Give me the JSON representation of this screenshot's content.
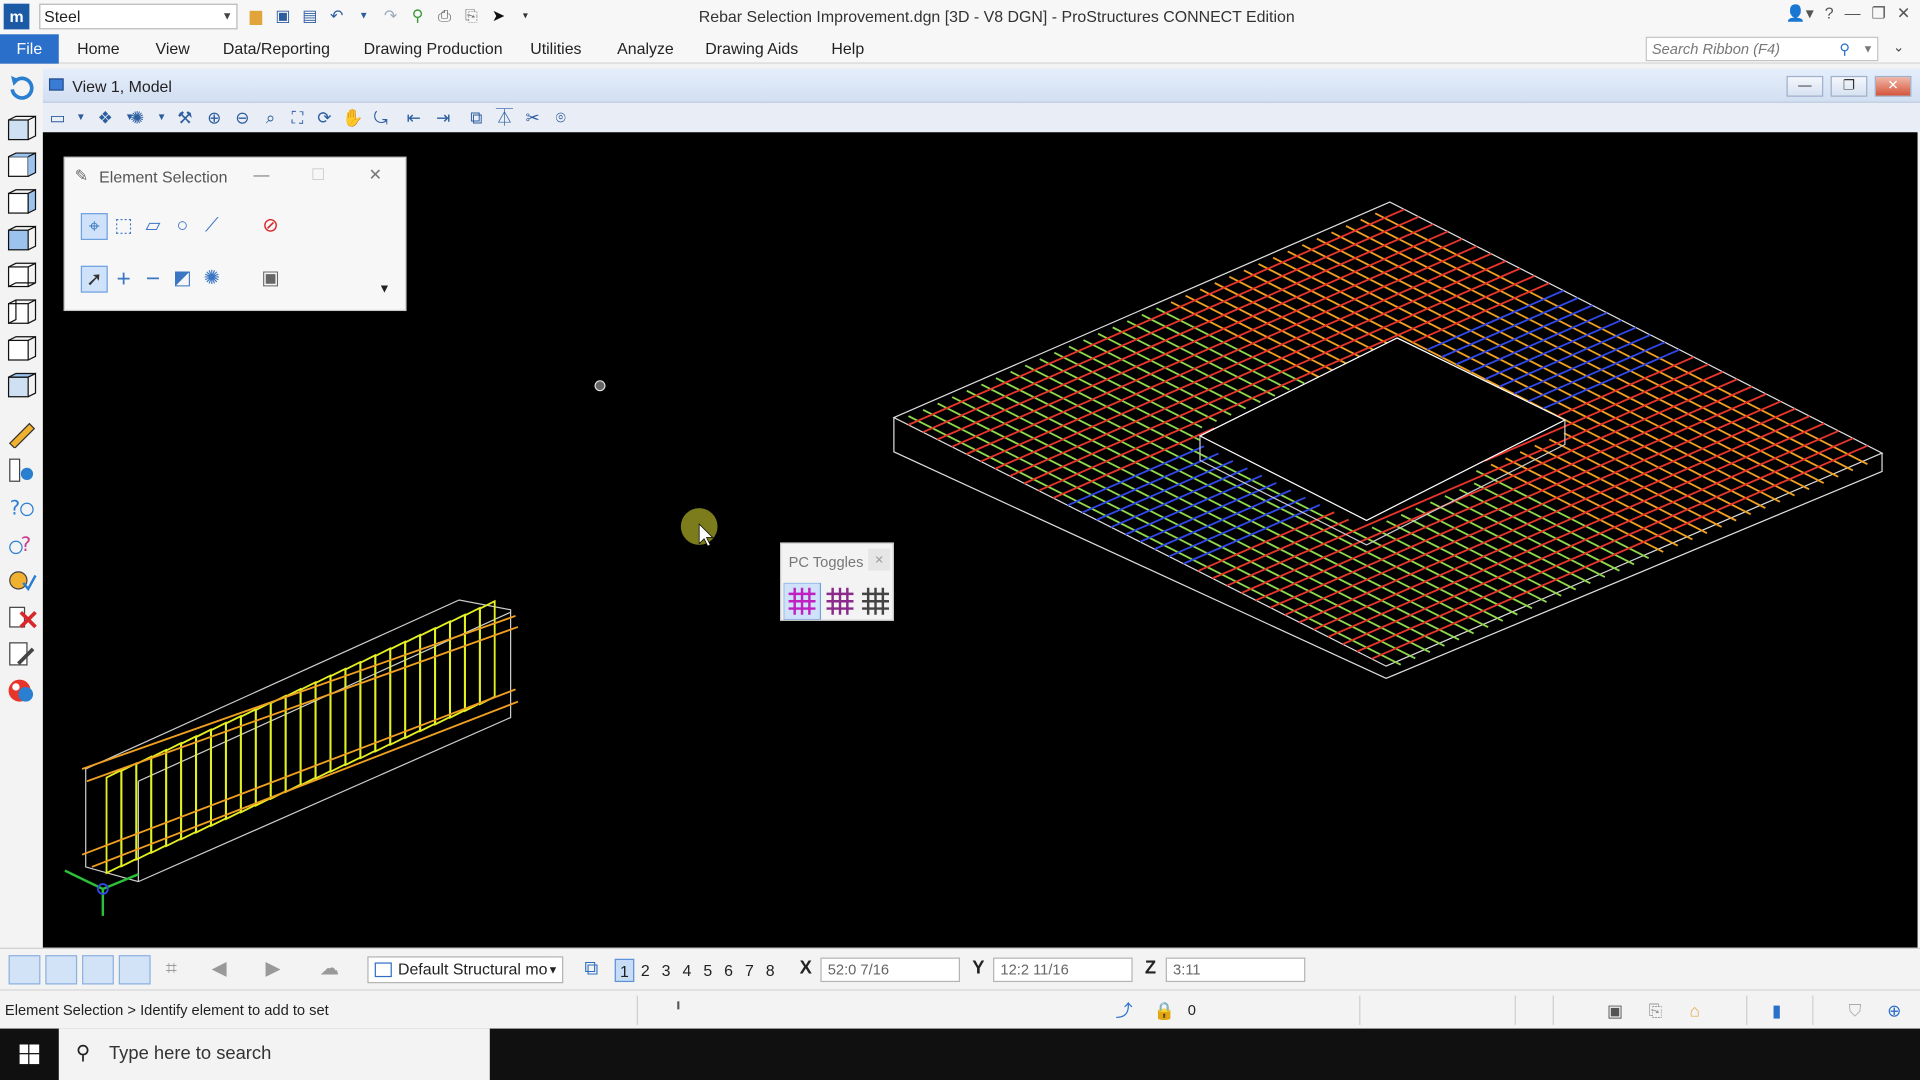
{
  "titlebar": {
    "workflow": "Steel",
    "title": "Rebar Selection Improvement.dgn [3D - V8 DGN] - ProStructures CONNECT Edition"
  },
  "ribbon": {
    "tabs": [
      "File",
      "Home",
      "View",
      "Data/Reporting",
      "Drawing Production",
      "Utilities",
      "Analyze",
      "Drawing Aids",
      "Help"
    ],
    "search_placeholder": "Search Ribbon (F4)"
  },
  "view": {
    "title": "View 1, Model"
  },
  "element_selection": {
    "title": "Element Selection"
  },
  "pc_toggles": {
    "title": "PC Toggles"
  },
  "statusbar": {
    "model": "Default Structural mo",
    "view_numbers": [
      "1",
      "2",
      "3",
      "4",
      "5",
      "6",
      "7",
      "8"
    ],
    "active_view": "1",
    "x_label": "X",
    "x_value": "52:0 7/16",
    "y_label": "Y",
    "y_value": "12:2 11/16",
    "z_label": "Z",
    "z_value": "3:11",
    "message": "Element Selection > Identify element to add to set",
    "level": "0"
  },
  "taskbar": {
    "search_placeholder": "Type here to search"
  },
  "colors": {
    "accent": "#2a6fc9",
    "canvas": "#000000",
    "rebar_red": "#e8352b",
    "rebar_orange": "#f0a020",
    "rebar_green": "#8fd84a",
    "rebar_blue": "#3048e8",
    "stirrup_yellow": "#e4f020"
  },
  "icons": [
    "home-icon",
    "save-icon",
    "undo-icon",
    "redo-icon",
    "print-icon",
    "zoom-in-icon",
    "zoom-out-icon",
    "fit-view-icon",
    "rotate-icon",
    "pan-icon",
    "windows-icon",
    "search-icon"
  ]
}
